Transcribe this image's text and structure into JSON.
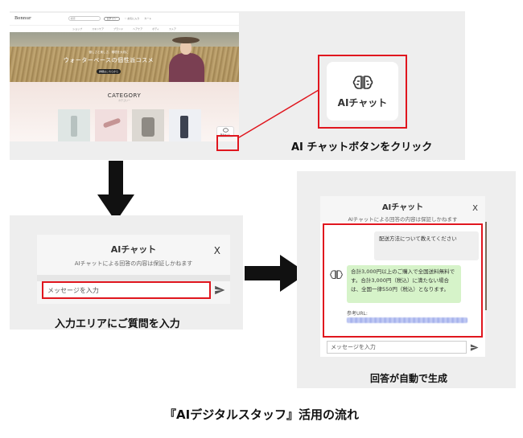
{
  "site": {
    "logo": "Bonnur",
    "search_placeholder": "検索",
    "login_label": "ログイン",
    "util_1": "♡ お気に入り",
    "util_2": "カート",
    "nav": [
      "ショップ",
      "スキンケア",
      "ブランド",
      "ヘアケア",
      "ボディ",
      "ストア"
    ],
    "hero_small": "優しさと美しさ、環境を大切に",
    "hero_title": "ウォーターベースの個性派コスメ",
    "hero_cta": "詳細はこちらから",
    "category_title": "CATEGORY",
    "category_sub": "カテゴリー",
    "chat_button_label": "AIチャット"
  },
  "zoom": {
    "label": "AIチャット",
    "icon": "brain-icon"
  },
  "captions": {
    "step1": "AI チャットボタンをクリック",
    "step2": "入力エリアにご質問を入力",
    "step3": "回答が自動で生成",
    "bottom": "『AIデジタルスタッフ』活用の流れ"
  },
  "chat": {
    "title": "AIチャット",
    "subtitle": "AIチャットによる回答の内容は保証しかねます",
    "close": "X",
    "input_placeholder": "メッセージを入力",
    "user_message": "配送方法について教えてください",
    "bot_message": "合計3,000円以上のご購入で全国送料無料です。合計3,000円（税込）に満たない場合は、全国一律550円（税込）となります。",
    "ref_label": "参考URL:"
  },
  "colors": {
    "highlight": "#e0161e",
    "bot_bubble": "#d6f3c9",
    "user_bubble": "#efefef",
    "panel": "#eeeeee"
  }
}
